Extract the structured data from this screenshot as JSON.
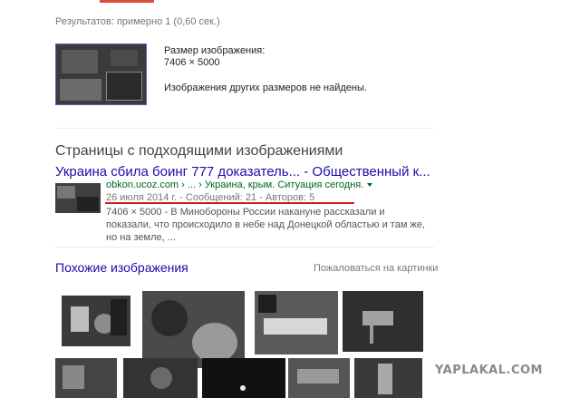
{
  "stats": {
    "text": "Результатов: примерно 1 (0,60 сек.)"
  },
  "image_info": {
    "size_label": "Размер изображения:",
    "size_value": "7406 × 5000",
    "other_sizes": "Изображения других размеров не найдены."
  },
  "pages_section": {
    "title": "Страницы с подходящими изображениями",
    "result": {
      "title": "Украина сбила боинг 777 доказатель... - Общественный к...",
      "url": "obkon.ucoz.com › ... › Украина, крым. Ситуация сегодня.",
      "meta": "26 июля 2014 г. - Сообщений: 21 - Авторов: 5",
      "snippet": "7406 × 5000 - В Минобороны России накануне рассказали и показали, что происходило в небе над Донецкой областью и там же, но на земле, ..."
    }
  },
  "similar_section": {
    "title": "Похожие изображения",
    "report_link": "Пожаловаться на картинки"
  },
  "watermark": "YAPLAKAL.COM",
  "colors": {
    "link": "#1a0dab",
    "url_green": "#006621",
    "annotation_red": "#d61a1a"
  }
}
